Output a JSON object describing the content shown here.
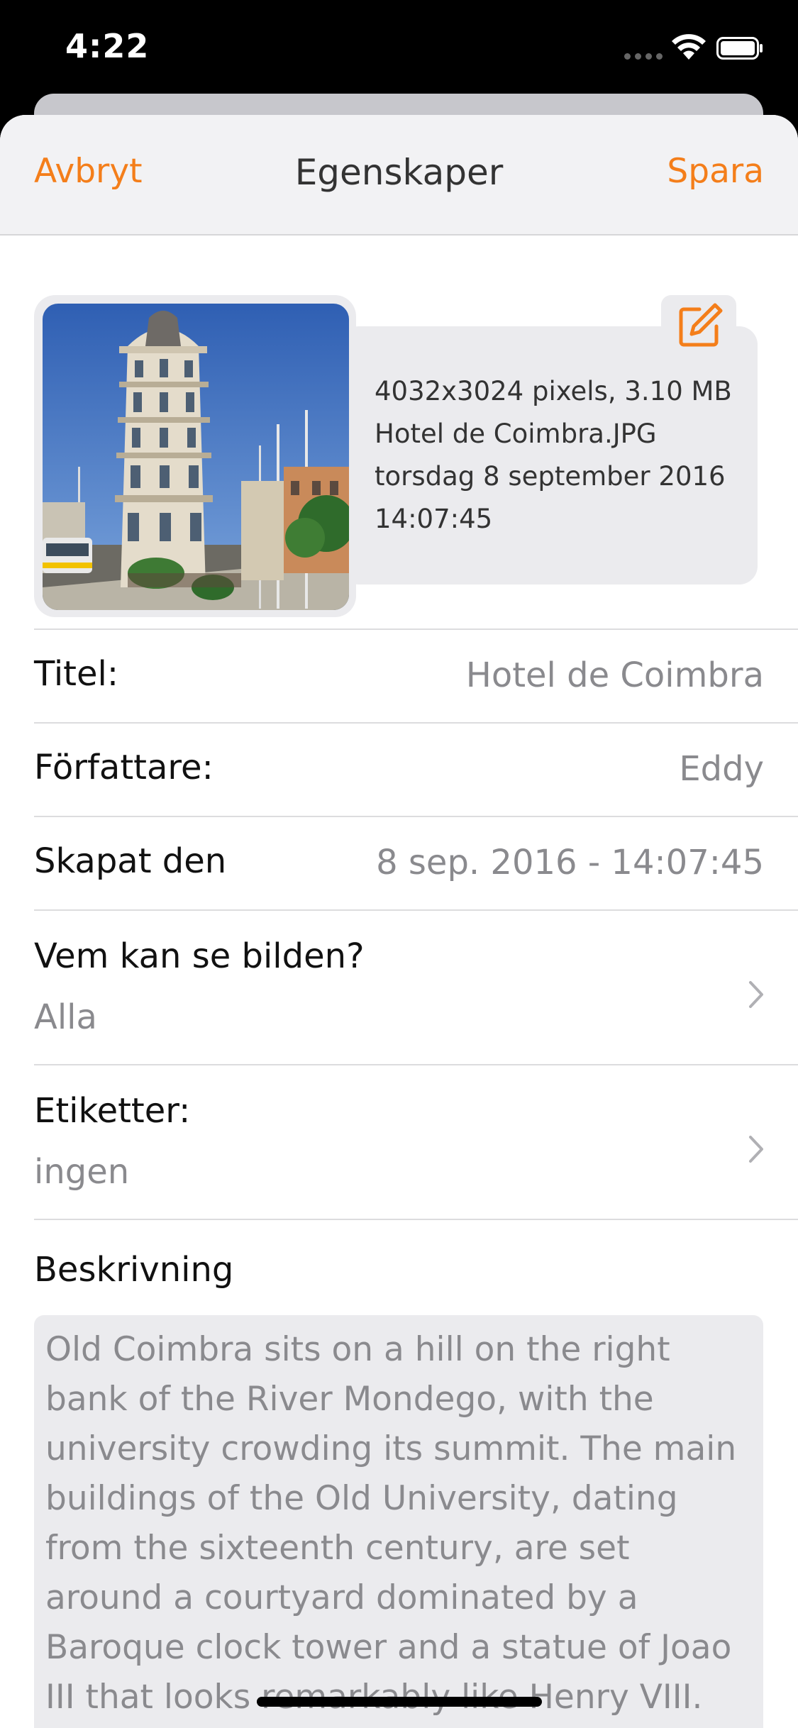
{
  "status": {
    "time": "4:22"
  },
  "nav": {
    "cancel": "Avbryt",
    "title": "Egenskaper",
    "save": "Spara"
  },
  "photo_info": {
    "line1": "4032x3024 pixels, 3.10 MB",
    "line2": "Hotel de Coimbra.JPG",
    "line3": "torsdag 8 september 2016",
    "line4": "14:07:45"
  },
  "fields": {
    "title_label": "Titel:",
    "title_value": "Hotel de Coimbra",
    "author_label": "Författare:",
    "author_value": "Eddy",
    "created_label": "Skapat den",
    "created_value": "8 sep. 2016 - 14:07:45",
    "visibility_label": "Vem kan se bilden?",
    "visibility_value": "Alla",
    "tags_label": "Etiketter:",
    "tags_value": "ingen"
  },
  "description": {
    "label": "Beskrivning",
    "text": "Old Coimbra sits on a hill on the right bank of the River Mondego, with the university crowding its summit. The main buildings of the Old University, dating from the sixteenth century, are set around a courtyard dominated by a Baroque clock tower and a statue of Joao III that looks remarkably like Henry VIII."
  },
  "colors": {
    "accent": "#f47e1a",
    "secondary_text": "#8a8a8e"
  },
  "icons": [
    "wifi-icon",
    "battery-icon",
    "edit-icon",
    "chevron-right-icon"
  ]
}
